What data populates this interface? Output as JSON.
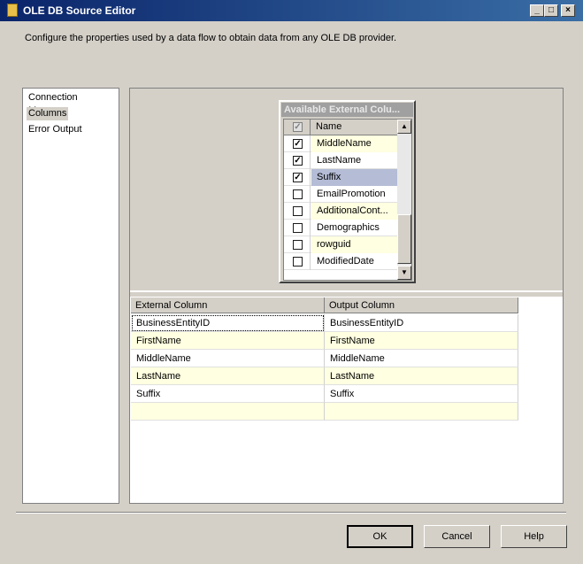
{
  "window": {
    "title": "OLE DB Source Editor",
    "controls": {
      "minimize": "_",
      "maximize": "□",
      "close": "×"
    }
  },
  "description": "Configure the properties used by a data flow to obtain data from any OLE DB provider.",
  "nav": {
    "items": [
      {
        "label": "Connection Manager"
      },
      {
        "label": "Columns"
      },
      {
        "label": "Error Output"
      }
    ],
    "selected": "Columns"
  },
  "available": {
    "title": "Available External Colu...",
    "header": "Name",
    "header_checked": "✓",
    "rows": [
      {
        "name": "MiddleName",
        "checked": "✓"
      },
      {
        "name": "LastName",
        "checked": "✓"
      },
      {
        "name": "Suffix",
        "checked": "✓"
      },
      {
        "name": "EmailPromotion",
        "checked": ""
      },
      {
        "name": "AdditionalCont...",
        "checked": ""
      },
      {
        "name": "Demographics",
        "checked": ""
      },
      {
        "name": "rowguid",
        "checked": ""
      },
      {
        "name": "ModifiedDate",
        "checked": ""
      }
    ],
    "scroll_up": "▲",
    "scroll_down": "▼"
  },
  "mapping": {
    "headers": [
      "External Column",
      "Output Column"
    ],
    "rows": [
      [
        "BusinessEntityID",
        "BusinessEntityID"
      ],
      [
        "FirstName",
        "FirstName"
      ],
      [
        "MiddleName",
        "MiddleName"
      ],
      [
        "LastName",
        "LastName"
      ],
      [
        "Suffix",
        "Suffix"
      ],
      [
        "",
        ""
      ]
    ]
  },
  "buttons": {
    "ok": "OK",
    "cancel": "Cancel",
    "help": "Help"
  },
  "colors": {
    "title_start": "#0a246a",
    "title_end": "#3a6ea5",
    "alt_row": "#ffffe1",
    "selected_row": "#b4bcd6"
  }
}
